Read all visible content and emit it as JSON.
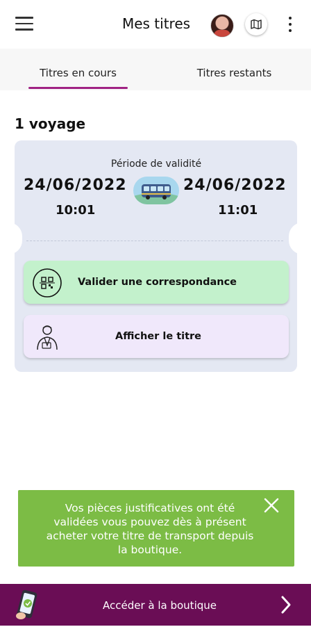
{
  "header": {
    "title": "Mes titres",
    "icons": {
      "menu": "menu-icon",
      "avatar": "user-avatar",
      "map": "map-icon",
      "more": "more-vertical-icon"
    }
  },
  "tabs": [
    {
      "label": "Titres en cours",
      "active": true
    },
    {
      "label": "Titres restants",
      "active": false
    }
  ],
  "section": {
    "heading": "1 voyage"
  },
  "ticket": {
    "validity_label": "Période de validité",
    "start_date": "24/06/2022",
    "start_time": "10:01",
    "end_date": "24/06/2022",
    "end_time": "11:01",
    "transport_icon": "bus-icon"
  },
  "actions": [
    {
      "label": "Valider une correspondance",
      "icon": "qr-scan-icon",
      "color": "#c3f1cc"
    },
    {
      "label": "Afficher le titre",
      "icon": "controller-icon",
      "color": "#f0e8fb"
    }
  ],
  "toast": {
    "message": "Vos pièces justificatives ont été validées vous pouvez dès à présent acheter votre titre de transport depuis la boutique.",
    "color": "#7cbc45"
  },
  "shop_bar": {
    "label": "Accéder à la boutique",
    "color": "#6a0d55",
    "icons": {
      "phone": "phone-shop-icon",
      "chevron": "chevron-right-icon"
    }
  },
  "colors": {
    "accent": "#a02283"
  }
}
